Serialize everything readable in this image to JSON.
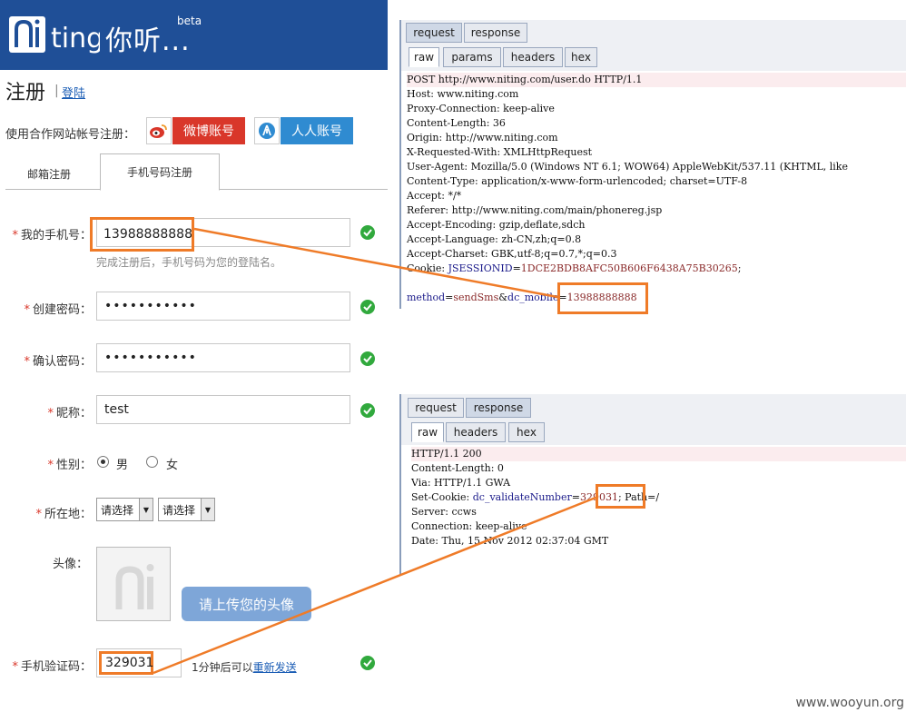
{
  "header": {
    "logo_cn": "你听...",
    "beta": "beta"
  },
  "page": {
    "title": "注册",
    "separator": "|",
    "login_link": "登陆"
  },
  "partner": {
    "label": "使用合作网站帐号注册：",
    "weibo": "微博账号",
    "renren": "人人账号"
  },
  "tabs": {
    "email": "邮箱注册",
    "phone": "手机号码注册"
  },
  "form": {
    "phone_label": "我的手机号：",
    "phone_value": "13988888888",
    "phone_hint": "完成注册后，手机号码为您的登陆名。",
    "pw_label": "创建密码：",
    "pw_value": "•••••••••••",
    "pw2_label": "确认密码：",
    "pw2_value": "•••••••••••",
    "nick_label": "昵称：",
    "nick_value": "test",
    "gender_label": "性别：",
    "male": "男",
    "female": "女",
    "location_label": "所在地：",
    "select1": "请选择",
    "select2": "请选择",
    "avatar_label": "头像：",
    "upload_btn": "请上传您的头像",
    "code_label": "手机验证码：",
    "code_value": "329031",
    "resend_prefix": "1分钟后可以",
    "resend_link": "重新发送"
  },
  "request_panel": {
    "tabs": [
      "request",
      "response"
    ],
    "subtabs": [
      "raw",
      "params",
      "headers",
      "hex"
    ],
    "lines": [
      "POST http://www.niting.com/user.do HTTP/1.1",
      "Host: www.niting.com",
      "Proxy-Connection: keep-alive",
      "Content-Length: 36",
      "Origin: http://www.niting.com",
      "X-Requested-With: XMLHttpRequest",
      "User-Agent: Mozilla/5.0 (Windows NT 6.1; WOW64) AppleWebKit/537.11 (KHTML, like",
      "Content-Type: application/x-www-form-urlencoded; charset=UTF-8",
      "Accept: */*",
      "Referer: http://www.niting.com/main/phonereg.jsp",
      "Accept-Encoding: gzip,deflate,sdch",
      "Accept-Language: zh-CN,zh;q=0.8",
      "Accept-Charset: GBK,utf-8;q=0.7,*;q=0.3"
    ],
    "cookie_prefix": "Cookie: ",
    "cookie_key": "JSESSIONID",
    "cookie_val": "1DCE2BDB8AFC50B606F6438A75B30265",
    "cookie_suffix": ";",
    "body_k1": "method",
    "body_v1": "sendSms",
    "body_amp": "&",
    "body_k2": "dc_mobile",
    "body_v2": "13988888888"
  },
  "response_panel": {
    "tabs": [
      "request",
      "response"
    ],
    "subtabs": [
      "raw",
      "headers",
      "hex"
    ],
    "line_status": "HTTP/1.1 200",
    "lines_a": [
      "Content-Length: 0",
      "Via: HTTP/1.1 GWA"
    ],
    "setcookie_prefix": "Set-Cookie: ",
    "setcookie_key": "dc_validateNumber",
    "setcookie_val": "329031",
    "setcookie_suffix": "; Path=/",
    "lines_b": [
      "Server: ccws",
      "Connection: keep-alive",
      "Date: Thu, 15 Nov 2012 02:37:04 GMT"
    ]
  },
  "watermark": "www.wooyun.org",
  "colors": {
    "header_blue": "#1f4f97",
    "annotation_orange": "#ef7b28",
    "weibo_red": "#d9372a",
    "renren_blue": "#2f8bd1",
    "ok_green": "#31a93d"
  }
}
